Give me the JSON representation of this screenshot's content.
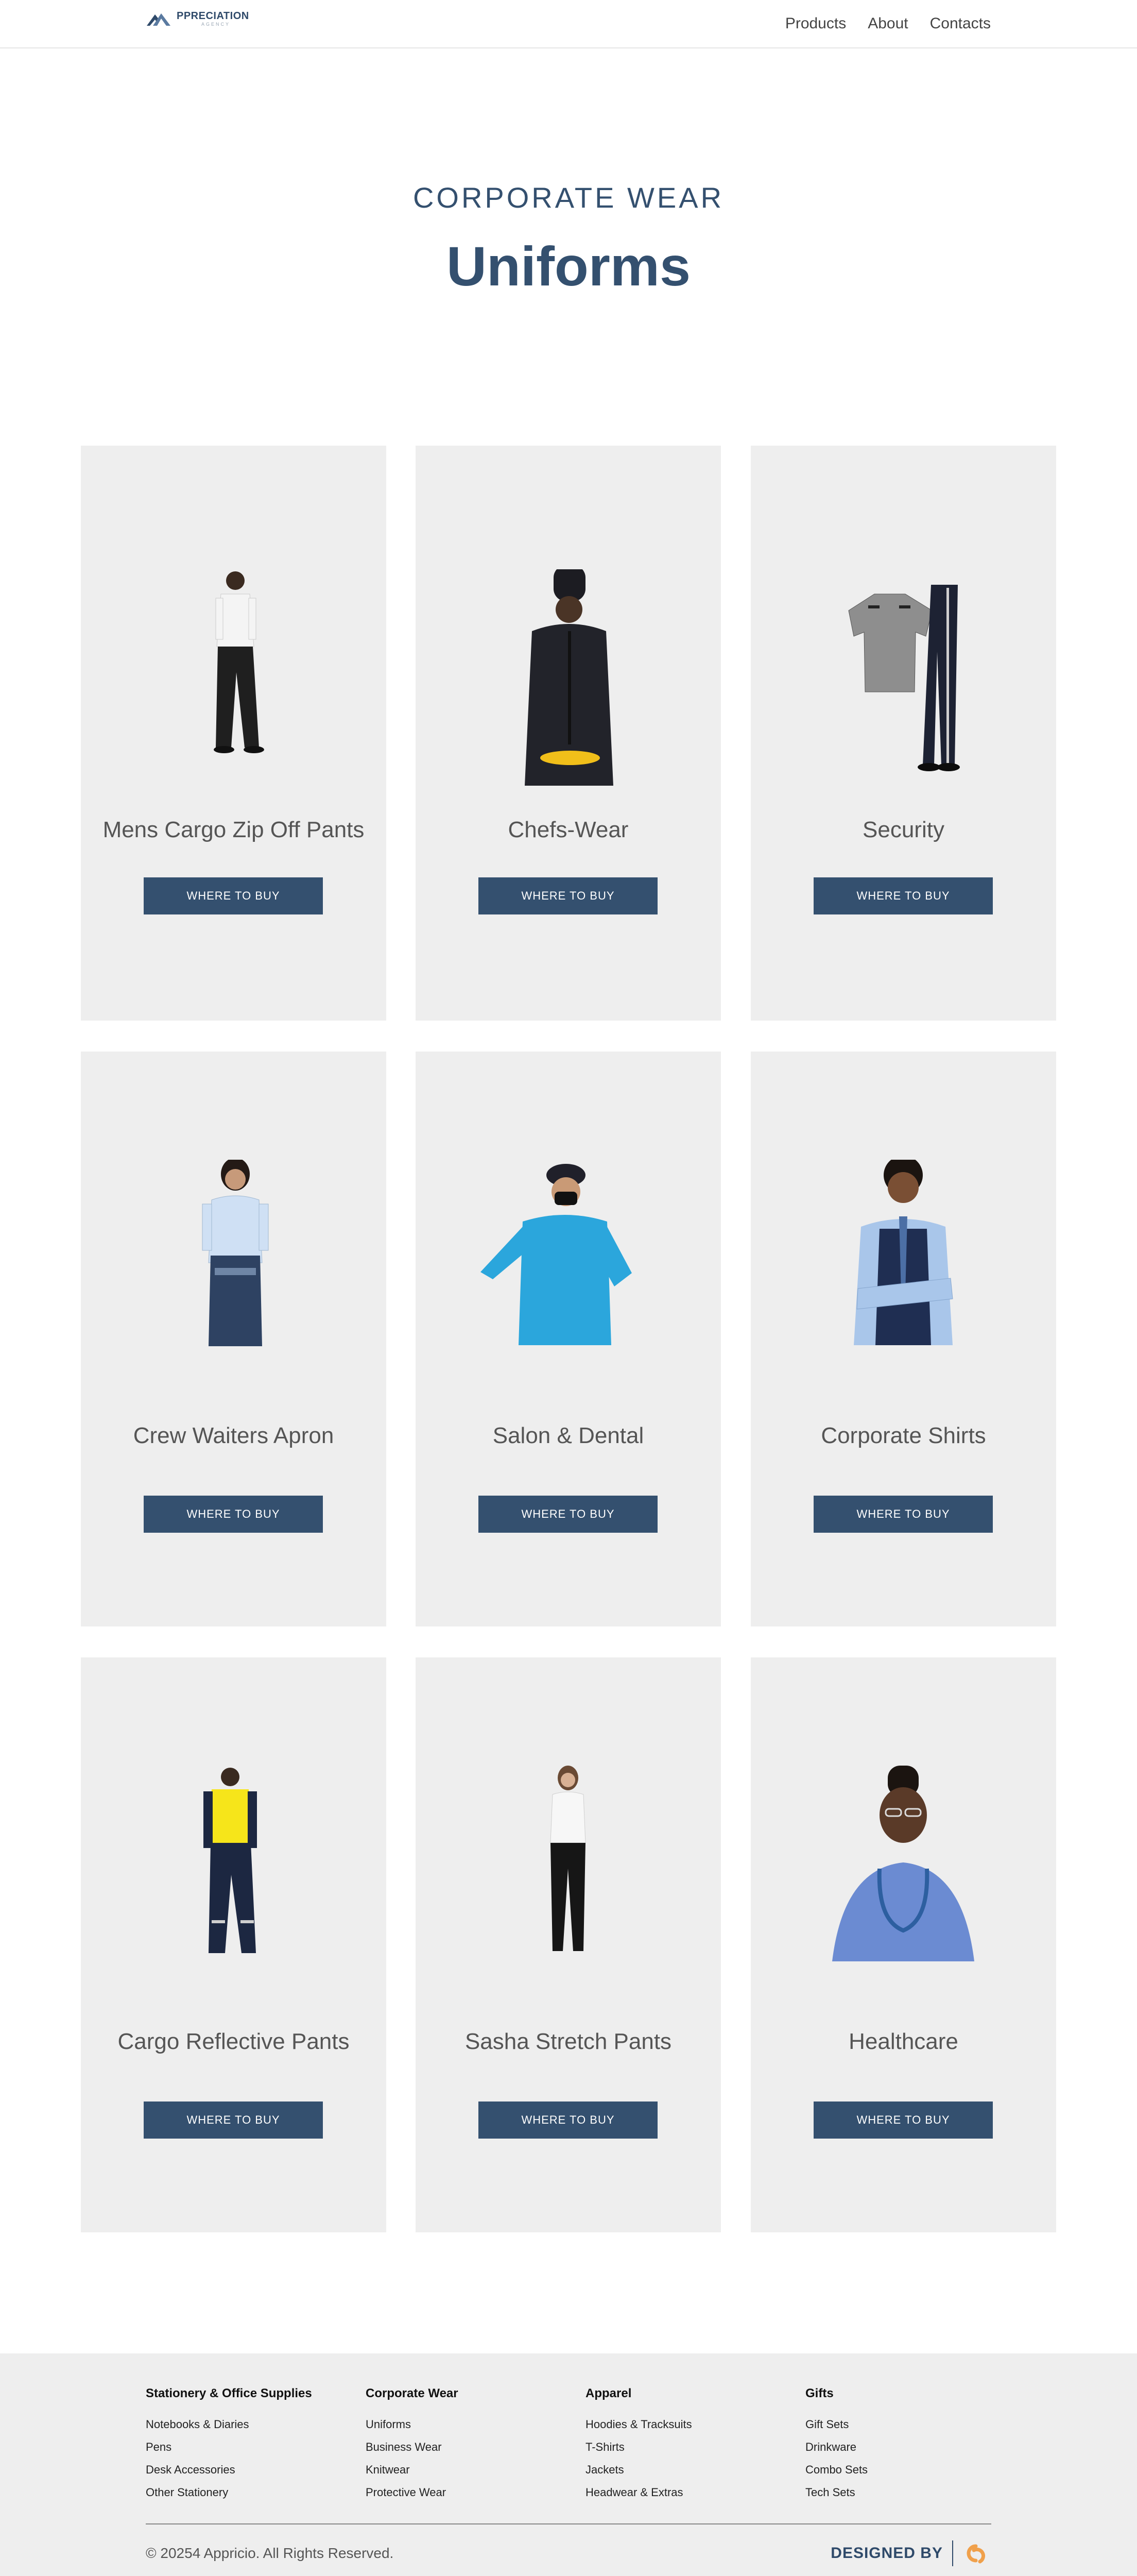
{
  "header": {
    "logo_text": "PPRECIATION",
    "logo_tagline": "AGENCY",
    "nav": [
      "Products",
      "About",
      "Contacts"
    ]
  },
  "hero": {
    "subtitle": "CORPORATE WEAR",
    "title": "Uniforms"
  },
  "products": [
    {
      "title": "Mens Cargo Zip Off Pants",
      "button": "WHERE TO BUY",
      "image": "man-cargo-pants"
    },
    {
      "title": "Chefs-Wear",
      "button": "WHERE TO BUY",
      "image": "chef-black-uniform"
    },
    {
      "title": "Security",
      "button": "WHERE TO BUY",
      "image": "security-shirt-pants"
    },
    {
      "title": "Crew Waiters Apron",
      "button": "WHERE TO BUY",
      "image": "waitress-apron"
    },
    {
      "title": "Salon & Dental",
      "button": "WHERE TO BUY",
      "image": "blue-tunic-mask"
    },
    {
      "title": "Corporate Shirts",
      "button": "WHERE TO BUY",
      "image": "woman-blue-shirt-vest"
    },
    {
      "title": "Cargo Reflective Pants",
      "button": "WHERE TO BUY",
      "image": "reflective-workwear"
    },
    {
      "title": "Sasha Stretch Pants",
      "button": "WHERE TO BUY",
      "image": "woman-stretch-pants"
    },
    {
      "title": "Healthcare",
      "button": "WHERE TO BUY",
      "image": "doctor-scrubs-stethoscope"
    }
  ],
  "footer": {
    "columns": [
      {
        "heading": "Stationery & Office Supplies",
        "links": [
          "Notebooks & Diaries",
          "Pens",
          "Desk Accessories",
          "Other Stationery"
        ]
      },
      {
        "heading": "Corporate Wear",
        "links": [
          "Uniforms",
          "Business Wear",
          "Knitwear",
          "Protective Wear"
        ]
      },
      {
        "heading": "Apparel",
        "links": [
          "Hoodies & Tracksuits",
          "T-Shirts",
          "Jackets",
          "Headwear & Extras"
        ]
      },
      {
        "heading": "Gifts",
        "links": [
          "Gift Sets",
          "Drinkware",
          "Combo Sets",
          "Tech Sets"
        ]
      }
    ],
    "copyright": "© 20254 Appricio. All Rights Reserved.",
    "designed_by": "DESIGNED BY"
  },
  "colors": {
    "brand": "#34506f",
    "card_bg": "#eeeeee",
    "designer_logo": "#f0a04b"
  }
}
